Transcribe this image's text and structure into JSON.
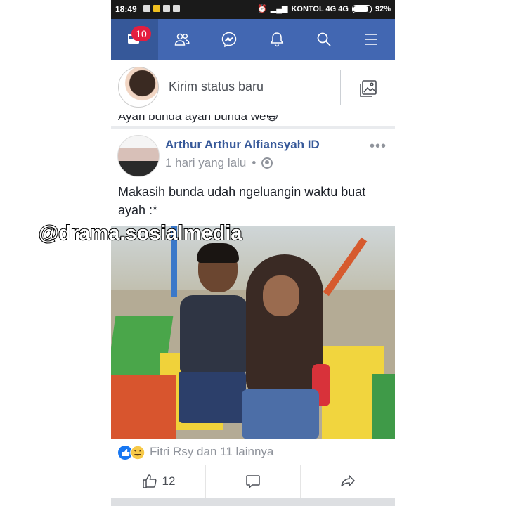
{
  "status_bar": {
    "time": "18:49",
    "carrier": "KONTOL 4G 4G",
    "battery": "92%"
  },
  "nav": {
    "items": [
      {
        "icon": "news-feed-icon",
        "badge": "10"
      },
      {
        "icon": "friends-icon"
      },
      {
        "icon": "messenger-icon"
      },
      {
        "icon": "bell-icon"
      },
      {
        "icon": "search-icon"
      },
      {
        "icon": "menu-icon"
      }
    ],
    "color": "#4267b2"
  },
  "composer": {
    "prompt": "Kirim status baru"
  },
  "previous_post": {
    "cutoff_text": "Ayah bunda ayah bunda we😄"
  },
  "post": {
    "author": "Arthur Arthur Alfiansyah ID",
    "time": "1 hari yang lalu",
    "separator": "•",
    "text": "Makasih bunda udah ngeluangin waktu buat ayah :*",
    "reactions_text": "Fitri Rsy dan 11 lainnya",
    "like_count": "12"
  },
  "watermark": "@drama.sosialmedia"
}
